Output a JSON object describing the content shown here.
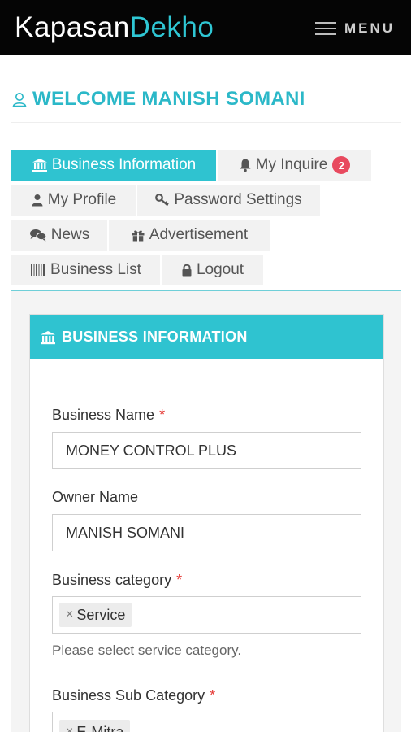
{
  "brand": {
    "part1": "Kapasan",
    "part2": "Dekho",
    "accent": "#2fc7d4"
  },
  "header": {
    "menu_label": "MENU",
    "menu_icon": "hamburger-icon"
  },
  "welcome": {
    "icon": "user-icon",
    "text": "WELCOME MANISH SOMANI"
  },
  "tabs": [
    {
      "label": "Business Information",
      "icon": "bank-icon",
      "active": true
    },
    {
      "label": "My Inquire",
      "icon": "bell-icon",
      "badge": "2"
    },
    {
      "label": "My Profile",
      "icon": "user-icon"
    },
    {
      "label": "Password Settings",
      "icon": "key-icon"
    },
    {
      "label": "News",
      "icon": "comments-icon"
    },
    {
      "label": "Advertisement",
      "icon": "gift-icon"
    },
    {
      "label": "Business List",
      "icon": "barcode-icon"
    },
    {
      "label": "Logout",
      "icon": "lock-icon"
    }
  ],
  "panel": {
    "title": "BUSINESS INFORMATION",
    "icon": "bank-icon",
    "fields": {
      "business_name": {
        "label": "Business Name",
        "required": "*",
        "value": "MONEY CONTROL PLUS"
      },
      "owner_name": {
        "label": "Owner Name",
        "value": "MANISH SOMANI"
      },
      "business_category": {
        "label": "Business category",
        "required": "*",
        "chip_remove": "×",
        "chip": "Service",
        "help": "Please select service category."
      },
      "business_sub_category": {
        "label": "Business Sub Category",
        "required": "*",
        "chip_remove": "×",
        "chip": "E-Mitra"
      }
    }
  },
  "colors": {
    "accent": "#2fc3d0",
    "badge": "#e84a5f",
    "required": "#e53935",
    "header_bg": "#050505"
  }
}
